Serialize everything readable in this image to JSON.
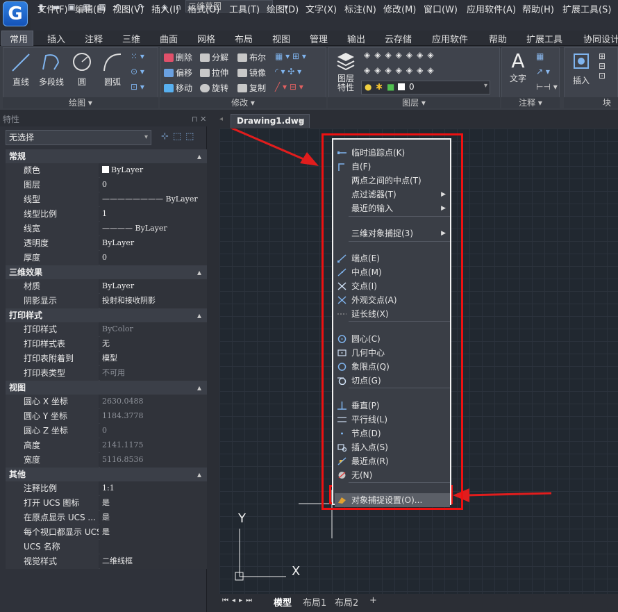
{
  "app": {
    "logo_letter": "G",
    "workspace": "二维草图",
    "accent_color": "#1f6fd6",
    "highlight_color": "#e11d1d"
  },
  "menubar": [
    "文件(F)",
    "编辑(E)",
    "视图(V)",
    "插入(I)",
    "格式(O)",
    "工具(T)",
    "绘图(D)",
    "文字(X)",
    "标注(N)",
    "修改(M)",
    "窗口(W)",
    "应用软件(A)",
    "帮助(H)",
    "扩展工具(S)"
  ],
  "ribbon_tabs": [
    "常用",
    "插入",
    "注释",
    "三维",
    "曲面",
    "网格",
    "布局",
    "视图",
    "管理",
    "输出",
    "云存储",
    "应用软件",
    "帮助",
    "扩展工具",
    "协同设计"
  ],
  "ribbon": {
    "draw": {
      "title": "绘图",
      "line": "直线",
      "polyline": "多段线",
      "circle": "圆",
      "arc": "圆弧"
    },
    "modify": {
      "title": "修改",
      "delete": "删除",
      "offset": "偏移",
      "move": "移动",
      "explode": "分解",
      "stretch": "拉伸",
      "rotate": "旋转",
      "boolean": "布尔",
      "mirror": "镜像",
      "copy": "复制"
    },
    "layers": {
      "title": "图层",
      "props": "图层\n特性",
      "current_layer": "0"
    },
    "annotate": {
      "title": "注释",
      "text": "文字"
    },
    "block": {
      "title": "块",
      "insert": "插入"
    }
  },
  "properties": {
    "title": "特性",
    "selection": "无选择",
    "sections": [
      {
        "name": "常规",
        "rows": [
          [
            "颜色",
            "ByLayer"
          ],
          [
            "图层",
            "0"
          ],
          [
            "线型",
            "———————— ByLayer"
          ],
          [
            "线型比例",
            "1"
          ],
          [
            "线宽",
            "———— ByLayer"
          ],
          [
            "透明度",
            "ByLayer"
          ],
          [
            "厚度",
            "0"
          ]
        ]
      },
      {
        "name": "三维效果",
        "rows": [
          [
            "材质",
            "ByLayer"
          ],
          [
            "阴影显示",
            "投射和接收阴影"
          ]
        ]
      },
      {
        "name": "打印样式",
        "rows": [
          [
            "打印样式",
            "ByColor"
          ],
          [
            "打印样式表",
            "无"
          ],
          [
            "打印表附着到",
            "模型"
          ],
          [
            "打印表类型",
            "不可用"
          ]
        ]
      },
      {
        "name": "视图",
        "rows": [
          [
            "圆心 X 坐标",
            "2630.0488"
          ],
          [
            "圆心 Y 坐标",
            "1184.3778"
          ],
          [
            "圆心 Z 坐标",
            "0"
          ],
          [
            "高度",
            "2141.1175"
          ],
          [
            "宽度",
            "5116.8536"
          ]
        ]
      },
      {
        "name": "其他",
        "rows": [
          [
            "注释比例",
            "1:1"
          ],
          [
            "打开 UCS 图标",
            "是"
          ],
          [
            "在原点显示 UCS ...",
            "是"
          ],
          [
            "每个视口都显示 UCS",
            "是"
          ],
          [
            "UCS 名称",
            ""
          ],
          [
            "视觉样式",
            "二维线框"
          ]
        ]
      }
    ]
  },
  "document": {
    "tab": "Drawing1.dwg",
    "close": "×"
  },
  "layout_tabs": [
    "模型",
    "布局1",
    "布局2",
    "+"
  ],
  "ucs": {
    "y": "Y",
    "x": "X"
  },
  "context_menu": {
    "items": [
      {
        "label": "临时追踪点(K)",
        "icon": "temp-track-icon"
      },
      {
        "label": "自(F)",
        "icon": "from-icon"
      },
      {
        "label": "两点之间的中点(T)",
        "icon": ""
      },
      {
        "label": "点过滤器(T)",
        "icon": "",
        "sub": true
      },
      {
        "label": "最近的输入",
        "icon": "",
        "sub": true
      },
      {
        "label": "三维对象捕捉(3)",
        "icon": "",
        "sub": true
      },
      {
        "label": "端点(E)",
        "icon": "endpoint-icon"
      },
      {
        "label": "中点(M)",
        "icon": "midpoint-icon"
      },
      {
        "label": "交点(I)",
        "icon": "intersection-icon"
      },
      {
        "label": "外观交点(A)",
        "icon": "apparent-intersection-icon"
      },
      {
        "label": "延长线(X)",
        "icon": "extension-icon"
      },
      {
        "label": "圆心(C)",
        "icon": "center-icon"
      },
      {
        "label": "几何中心",
        "icon": "geometric-center-icon"
      },
      {
        "label": "象限点(Q)",
        "icon": "quadrant-icon"
      },
      {
        "label": "切点(G)",
        "icon": "tangent-icon"
      },
      {
        "label": "垂直(P)",
        "icon": "perpendicular-icon"
      },
      {
        "label": "平行线(L)",
        "icon": "parallel-icon"
      },
      {
        "label": "节点(D)",
        "icon": "node-icon"
      },
      {
        "label": "插入点(S)",
        "icon": "insertion-icon"
      },
      {
        "label": "最近点(R)",
        "icon": "nearest-icon"
      },
      {
        "label": "无(N)",
        "icon": "none-icon"
      },
      {
        "label": "对象捕捉设置(O)...",
        "icon": "osnap-settings-icon"
      }
    ]
  }
}
